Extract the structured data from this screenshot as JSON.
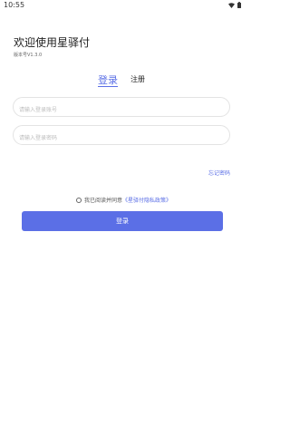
{
  "status_bar": {
    "time": "10:55",
    "icons": [
      "wifi-icon",
      "battery-icon"
    ]
  },
  "header": {
    "welcome": "欢迎使用星驿付",
    "version": "版本号V1.3.0"
  },
  "tabs": [
    {
      "label": "登录",
      "active": true
    },
    {
      "label": "注册",
      "active": false
    }
  ],
  "form": {
    "account_placeholder": "请输入登录账号",
    "password_placeholder": "请输入登录密码",
    "forgot_label": "忘记密码"
  },
  "agreement": {
    "prefix": "我已阅读并同意",
    "link": "《星驿付隐私政策》",
    "checked": false
  },
  "login_button": {
    "label": "登录"
  },
  "colors": {
    "accent": "#5b6fe6"
  }
}
